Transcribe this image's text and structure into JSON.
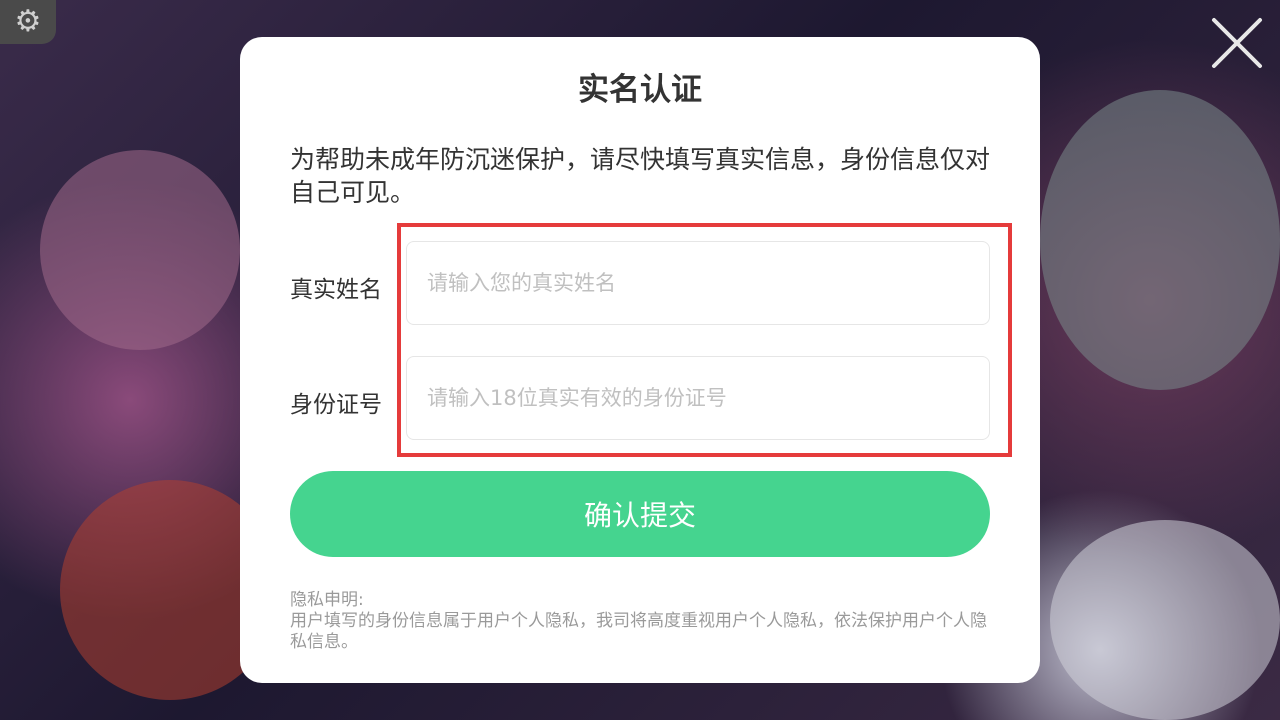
{
  "settings": {
    "icon": "gear-icon"
  },
  "close": {
    "icon": "close-icon"
  },
  "dialog": {
    "title": "实名认证",
    "intro": "为帮助未成年防沉迷保护，请尽快填写真实信息，身份信息仅对自己可见。",
    "name_field": {
      "label": "真实姓名",
      "placeholder": "请输入您的真实姓名",
      "value": ""
    },
    "id_field": {
      "label": "身份证号",
      "placeholder": "请输入18位真实有效的身份证号",
      "value": ""
    },
    "submit_label": "确认提交",
    "privacy_title": "隐私申明:",
    "privacy_text": "用户填写的身份信息属于用户个人隐私，我司将高度重视用户个人隐私，依法保护用户个人隐私信息。"
  },
  "colors": {
    "accent": "#45d48f",
    "highlight": "#e53b3b"
  }
}
